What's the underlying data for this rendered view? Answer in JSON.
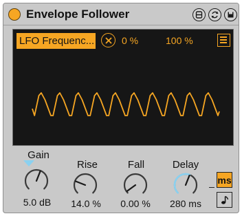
{
  "device": {
    "title": "Envelope Follower",
    "colors": {
      "accent": "#f6a623",
      "panel": "#c9c9c9",
      "display_bg": "#161616",
      "knob_track": "#3a3a3a",
      "delay_arc": "#8ad1f0"
    }
  },
  "display": {
    "target_label": "LFO Frequenc...",
    "range_min": "0 %",
    "range_max": "100 %",
    "waveform": {
      "cycles": 10
    }
  },
  "knobs": [
    {
      "id": "gain",
      "label": "Gain",
      "value": "5.0 dB"
    },
    {
      "id": "rise",
      "label": "Rise",
      "value": "14.0 %"
    },
    {
      "id": "fall",
      "label": "Fall",
      "value": "0.00 %"
    },
    {
      "id": "delay",
      "label": "Delay",
      "value": "280 ms"
    }
  ],
  "delay_mode": {
    "ms_label": "ms",
    "note_icon": "note-icon",
    "selected": "ms"
  }
}
